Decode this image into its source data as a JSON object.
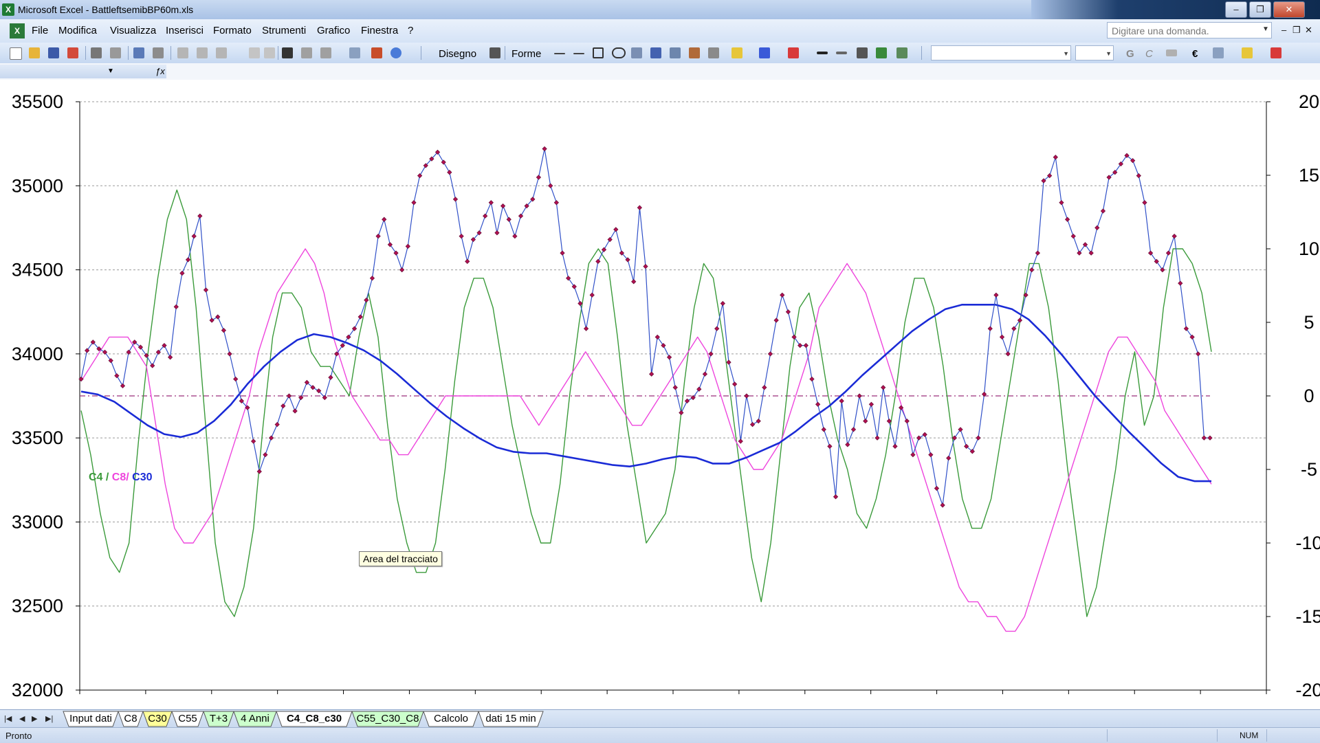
{
  "window": {
    "title": "Microsoft Excel - BattleftsemibBP60m.xls",
    "minimize": "–",
    "restore": "❐",
    "close": "✕"
  },
  "menu": {
    "items": [
      "File",
      "Modifica",
      "Visualizza",
      "Inserisci",
      "Formato",
      "Strumenti",
      "Grafico",
      "Finestra",
      "?"
    ],
    "help_placeholder": "Digitare una domanda."
  },
  "toolbar": {
    "draw_label": "Disegno",
    "shapes_label": "Forme",
    "bold": "G",
    "italic": "C",
    "euro": "€"
  },
  "colors": {
    "c4": "#3a9a3a",
    "c8": "#ee44dd",
    "c30": "#1a2bd6",
    "price_line": "#3050c8",
    "price_marker": "#b01050",
    "zero_line": "#9b2f7b"
  },
  "chart_data": {
    "type": "line",
    "tooltip": "Area del tracciato",
    "legend": {
      "c4": "C4",
      "c8": "C8",
      "c30": "C30",
      "sep1": " / ",
      "sep2": "/ ",
      "placement": "left-middle"
    },
    "y_left": {
      "min": 32000,
      "max": 35500,
      "ticks": [
        "35500",
        "35000",
        "34500",
        "34000",
        "33500",
        "33000",
        "32500",
        "32000"
      ]
    },
    "y_right": {
      "min": -20,
      "max": 20,
      "ticks": [
        "20",
        "15",
        "10",
        "5",
        "0",
        "-5",
        "-10",
        "-15",
        "-20"
      ]
    },
    "grid": true,
    "price": [
      33850,
      34020,
      34070,
      34030,
      34010,
      33960,
      33870,
      33810,
      34010,
      34070,
      34040,
      33990,
      33930,
      34010,
      34050,
      33980,
      34280,
      34480,
      34560,
      34700,
      34820,
      34380,
      34200,
      34220,
      34140,
      34000,
      33850,
      33720,
      33680,
      33480,
      33300,
      33400,
      33500,
      33580,
      33690,
      33750,
      33660,
      33740,
      33830,
      33800,
      33780,
      33740,
      33860,
      34000,
      34050,
      34100,
      34150,
      34220,
      34320,
      34450,
      34700,
      34800,
      34650,
      34600,
      34500,
      34640,
      34900,
      35060,
      35120,
      35160,
      35200,
      35140,
      35080,
      34920,
      34700,
      34550,
      34680,
      34720,
      34820,
      34900,
      34720,
      34880,
      34800,
      34700,
      34820,
      34880,
      34920,
      35050,
      35220,
      35000,
      34900,
      34600,
      34450,
      34400,
      34300,
      34150,
      34350,
      34550,
      34620,
      34680,
      34740,
      34600,
      34560,
      34430,
      34870,
      34520,
      33880,
      34100,
      34050,
      33980,
      33800,
      33650,
      33720,
      33740,
      33790,
      33880,
      34000,
      34150,
      34300,
      33950,
      33820,
      33480,
      33750,
      33580,
      33600,
      33800,
      34000,
      34200,
      34350,
      34250,
      34100,
      34050,
      34050,
      33850,
      33700,
      33550,
      33450,
      33150,
      33720,
      33460,
      33550,
      33750,
      33600,
      33700,
      33500,
      33800,
      33600,
      33450,
      33680,
      33600,
      33400,
      33500,
      33520,
      33400,
      33200,
      33100,
      33380,
      33500,
      33550,
      33450,
      33420,
      33500,
      33760,
      34150,
      34350,
      34100,
      34000,
      34150,
      34200,
      34350,
      34500,
      34600,
      35030,
      35060,
      35170,
      34900,
      34800,
      34700,
      34600,
      34650,
      34600,
      34750,
      34850,
      35050,
      35080,
      35130,
      35180,
      35150,
      35060,
      34900,
      34600,
      34550,
      34500,
      34600,
      34700,
      34420,
      34150,
      34100,
      34000,
      33500,
      33500
    ],
    "c4": [
      -1,
      -4,
      -8,
      -11,
      -12,
      -10,
      -3,
      3,
      8,
      12,
      14,
      12,
      6,
      -2,
      -10,
      -14,
      -15,
      -13,
      -9,
      -2,
      4,
      7,
      7,
      6,
      3,
      2,
      2,
      1,
      0,
      4,
      7,
      4,
      -2,
      -7,
      -10,
      -12,
      -12,
      -10,
      -5,
      1,
      6,
      8,
      8,
      6,
      2,
      -2,
      -5,
      -8,
      -10,
      -10,
      -6,
      0,
      5,
      9,
      10,
      9,
      4,
      -2,
      -6,
      -10,
      -9,
      -8,
      -5,
      1,
      6,
      9,
      8,
      4,
      -1,
      -6,
      -11,
      -14,
      -10,
      -4,
      2,
      6,
      7,
      4,
      0,
      -3,
      -5,
      -8,
      -9,
      -7,
      -4,
      0,
      5,
      8,
      8,
      6,
      2,
      -3,
      -7,
      -9,
      -9,
      -7,
      -3,
      1,
      5,
      9,
      9,
      6,
      1,
      -5,
      -10,
      -15,
      -13,
      -9,
      -5,
      0,
      3,
      -2,
      0,
      6,
      10,
      10,
      9,
      7,
      3
    ],
    "c8": [
      1,
      2,
      3,
      4,
      4,
      4,
      3,
      2,
      -2,
      -6,
      -9,
      -10,
      -10,
      -9,
      -8,
      -6,
      -4,
      -2,
      0,
      3,
      5,
      7,
      8,
      9,
      10,
      9,
      7,
      4,
      2,
      0,
      -1,
      -2,
      -3,
      -3,
      -4,
      -4,
      -3,
      -2,
      -1,
      0,
      0,
      0,
      0,
      0,
      0,
      0,
      0,
      0,
      -1,
      -2,
      -1,
      0,
      1,
      2,
      3,
      2,
      1,
      0,
      -1,
      -2,
      -2,
      -1,
      0,
      1,
      2,
      3,
      4,
      3,
      1,
      -1,
      -3,
      -4,
      -5,
      -5,
      -4,
      -3,
      -1,
      1,
      3,
      6,
      7,
      8,
      9,
      8,
      7,
      5,
      3,
      1,
      -1,
      -3,
      -5,
      -7,
      -9,
      -11,
      -13,
      -14,
      -14,
      -15,
      -15,
      -16,
      -16,
      -15,
      -13,
      -11,
      -9,
      -7,
      -5,
      -3,
      -1,
      1,
      3,
      4,
      4,
      3,
      2,
      1,
      -1,
      -2,
      -3,
      -4,
      -5,
      -6
    ],
    "c30": [
      0.3,
      0.1,
      -0.4,
      -1.2,
      -2.0,
      -2.6,
      -2.8,
      -2.5,
      -1.7,
      -0.6,
      0.8,
      2.0,
      3.0,
      3.8,
      4.2,
      4.0,
      3.6,
      3.1,
      2.4,
      1.5,
      0.5,
      -0.5,
      -1.4,
      -2.2,
      -2.9,
      -3.5,
      -3.8,
      -3.9,
      -3.9,
      -4.1,
      -4.3,
      -4.5,
      -4.7,
      -4.8,
      -4.6,
      -4.3,
      -4.1,
      -4.2,
      -4.6,
      -4.6,
      -4.2,
      -3.7,
      -3.2,
      -2.4,
      -1.5,
      -0.7,
      0.3,
      1.4,
      2.4,
      3.4,
      4.4,
      5.2,
      5.9,
      6.2,
      6.2,
      6.2,
      5.9,
      5.2,
      4.1,
      2.8,
      1.4,
      0.0,
      -1.2,
      -2.4,
      -3.5,
      -4.6,
      -5.5,
      -5.8,
      -5.8
    ]
  },
  "sheet_tabs": [
    "Input dati",
    "C8",
    "C30",
    "C55",
    "T+3",
    "4 Anni",
    "C4_C8_c30",
    "C55_C30_C8",
    "Calcolo",
    "dati 15 min"
  ],
  "status": {
    "left": "Pronto",
    "num": "NUM"
  }
}
